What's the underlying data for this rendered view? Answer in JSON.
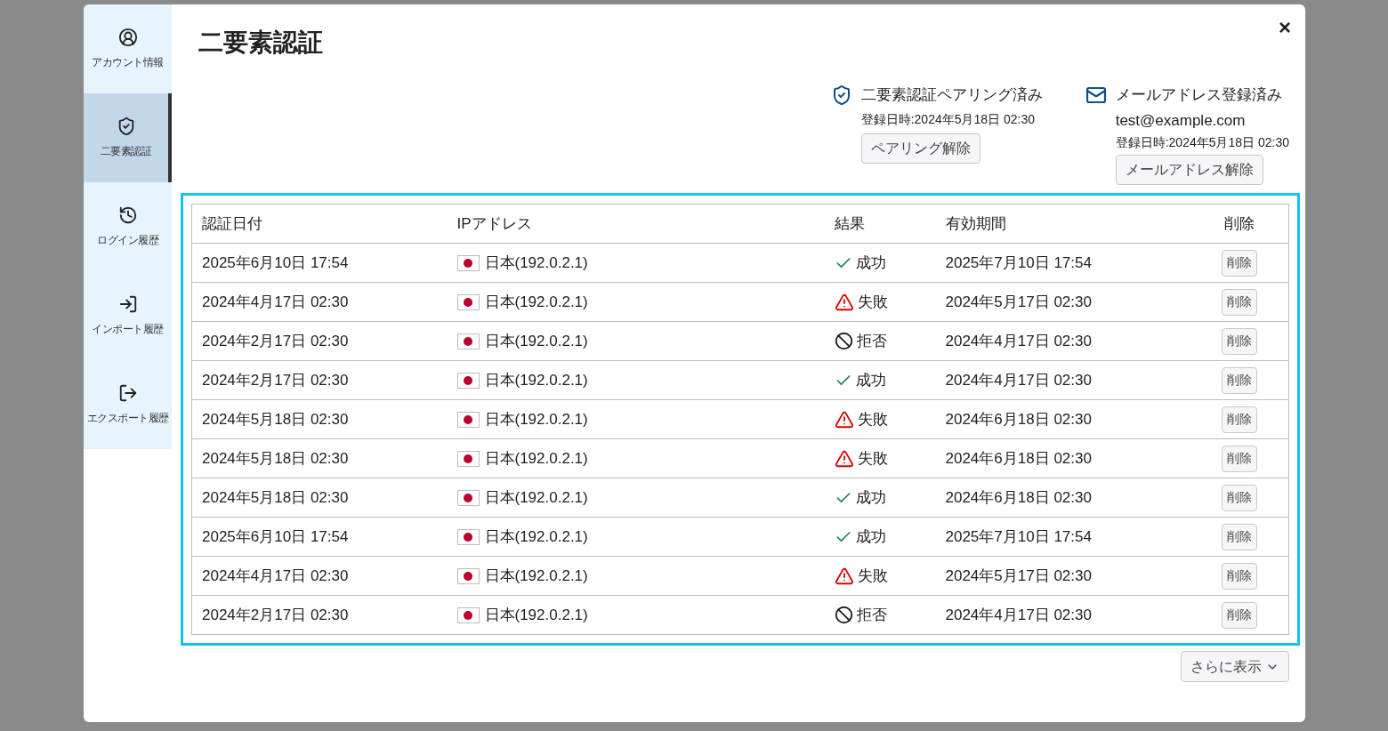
{
  "sidebar": {
    "items": [
      {
        "kind": "account",
        "label": "アカウント情報",
        "selected": false
      },
      {
        "kind": "security",
        "label": "二要素認証",
        "selected": true
      },
      {
        "kind": "history",
        "label": "ログイン履歴",
        "selected": false
      },
      {
        "kind": "import",
        "label": "インポート履歴",
        "selected": false
      },
      {
        "kind": "export",
        "label": "エクスポート履歴",
        "selected": false
      }
    ]
  },
  "title": "二要素認証",
  "close": "×",
  "pairing": {
    "status": "二要素認証ペアリング済み",
    "registered": "登録日時:2024年5月18日 02:30",
    "button": "ペアリング解除"
  },
  "email": {
    "status": "メールアドレス登録済み",
    "address": "test@example.com",
    "registered": "登録日時:2024年5月18日 02:30",
    "button": "メールアドレス解除"
  },
  "table": {
    "columns": [
      "認証日付",
      "IPアドレス",
      "結果",
      "有効期間",
      "削除"
    ],
    "rows": [
      {
        "date": "2025年6月10日 17:54",
        "ip": "日本(192.0.2.1)",
        "result": {
          "kind": "success",
          "label": "成功"
        },
        "expiry": "2025年7月10日 17:54",
        "delete": "削除"
      },
      {
        "date": "2024年4月17日 02:30",
        "ip": "日本(192.0.2.1)",
        "result": {
          "kind": "failure",
          "label": "失敗"
        },
        "expiry": "2024年5月17日 02:30",
        "delete": "削除"
      },
      {
        "date": "2024年2月17日 02:30",
        "ip": "日本(192.0.2.1)",
        "result": {
          "kind": "rejected",
          "label": "拒否"
        },
        "expiry": "2024年4月17日 02:30",
        "delete": "削除"
      },
      {
        "date": "2024年2月17日 02:30",
        "ip": "日本(192.0.2.1)",
        "result": {
          "kind": "success",
          "label": "成功"
        },
        "expiry": "2024年4月17日 02:30",
        "delete": "削除"
      },
      {
        "date": "2024年5月18日 02:30",
        "ip": "日本(192.0.2.1)",
        "result": {
          "kind": "failure",
          "label": "失敗"
        },
        "expiry": "2024年6月18日 02:30",
        "delete": "削除"
      },
      {
        "date": "2024年5月18日 02:30",
        "ip": "日本(192.0.2.1)",
        "result": {
          "kind": "failure",
          "label": "失敗"
        },
        "expiry": "2024年6月18日 02:30",
        "delete": "削除"
      },
      {
        "date": "2024年5月18日 02:30",
        "ip": "日本(192.0.2.1)",
        "result": {
          "kind": "success",
          "label": "成功"
        },
        "expiry": "2024年6月18日 02:30",
        "delete": "削除"
      },
      {
        "date": "2025年6月10日 17:54",
        "ip": "日本(192.0.2.1)",
        "result": {
          "kind": "success",
          "label": "成功"
        },
        "expiry": "2025年7月10日 17:54",
        "delete": "削除"
      },
      {
        "date": "2024年4月17日 02:30",
        "ip": "日本(192.0.2.1)",
        "result": {
          "kind": "failure",
          "label": "失敗"
        },
        "expiry": "2024年5月17日 02:30",
        "delete": "削除"
      },
      {
        "date": "2024年2月17日 02:30",
        "ip": "日本(192.0.2.1)",
        "result": {
          "kind": "rejected",
          "label": "拒否"
        },
        "expiry": "2024年4月17日 02:30",
        "delete": "削除"
      }
    ]
  },
  "more": "さらに表示"
}
